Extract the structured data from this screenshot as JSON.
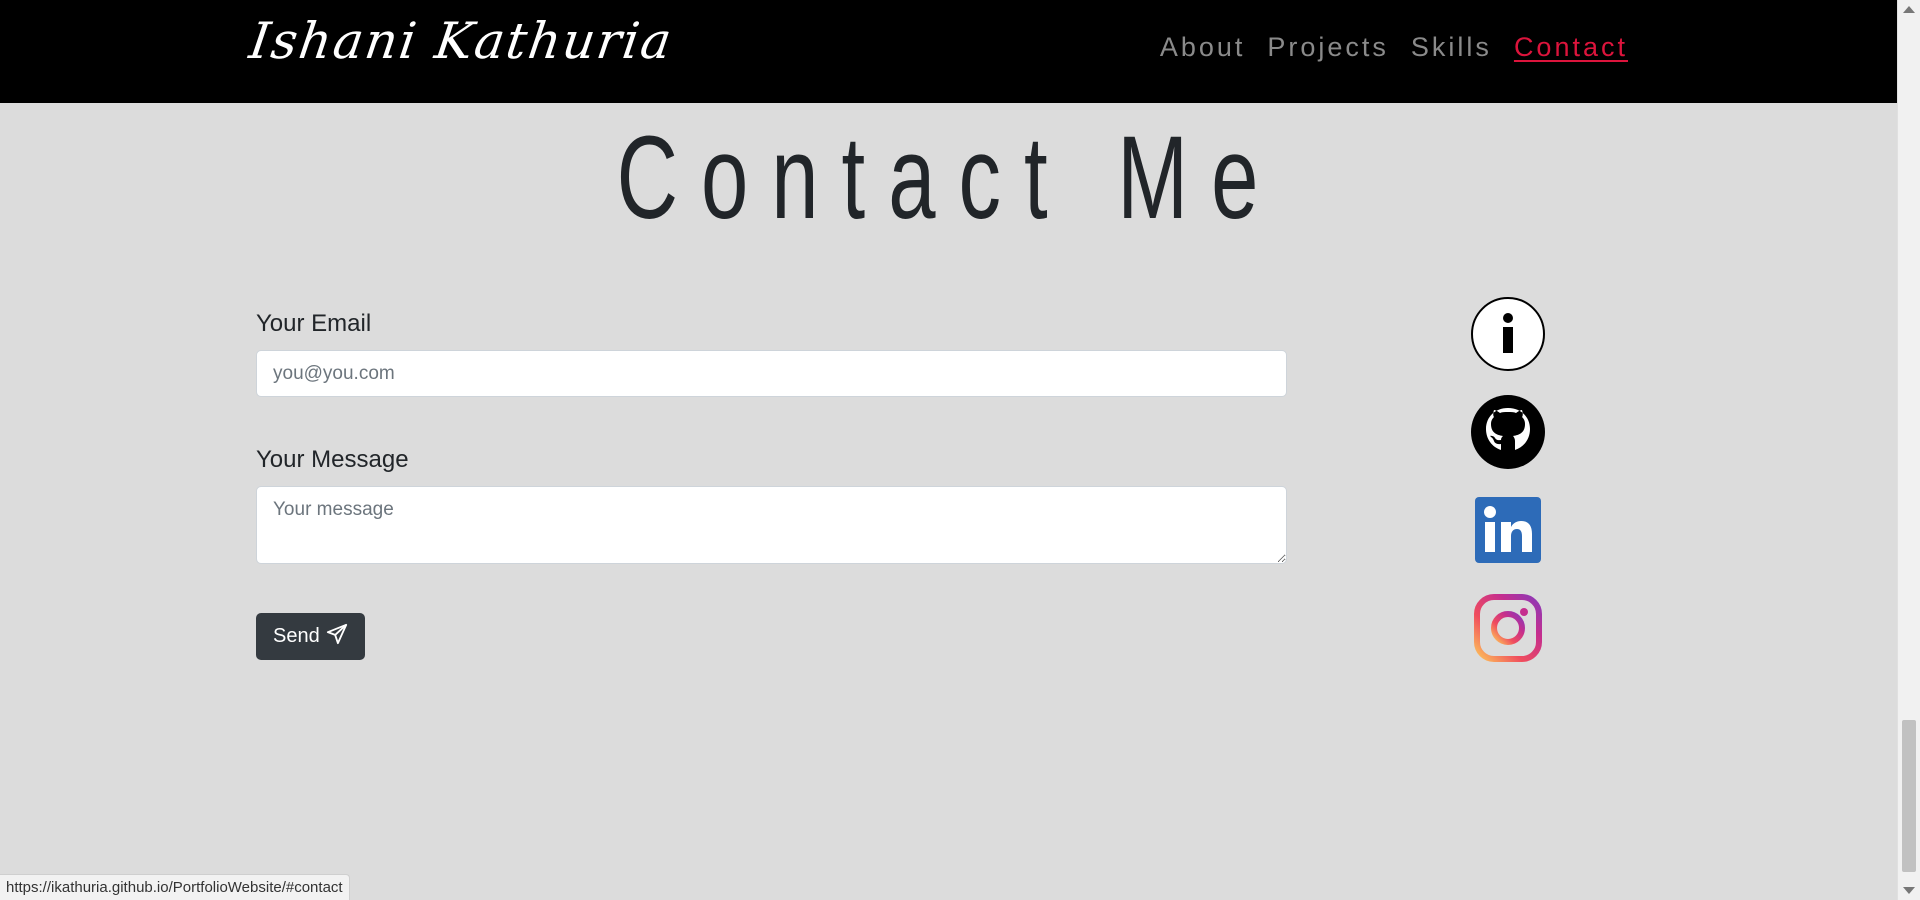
{
  "navbar": {
    "brand": "Ishani Kathuria",
    "links": [
      "About",
      "Projects",
      "Skills",
      "Contact"
    ],
    "active": "Contact"
  },
  "heading": "Contact Me",
  "form": {
    "email_label": "Your Email",
    "email_placeholder": "you@you.com",
    "message_label": "Your Message",
    "message_placeholder": "Your message",
    "send_label": "Send"
  },
  "social": [
    {
      "icon": "info-icon"
    },
    {
      "icon": "github-icon"
    },
    {
      "icon": "linkedin-icon"
    },
    {
      "icon": "instagram-icon"
    }
  ],
  "status_url": "https://ikathuria.github.io/PortfolioWebsite/#contact",
  "colors": {
    "navbar_bg": "#000000",
    "active_link": "#dc143c",
    "page_bg": "#dcdcdc",
    "button_bg": "#343a40"
  }
}
